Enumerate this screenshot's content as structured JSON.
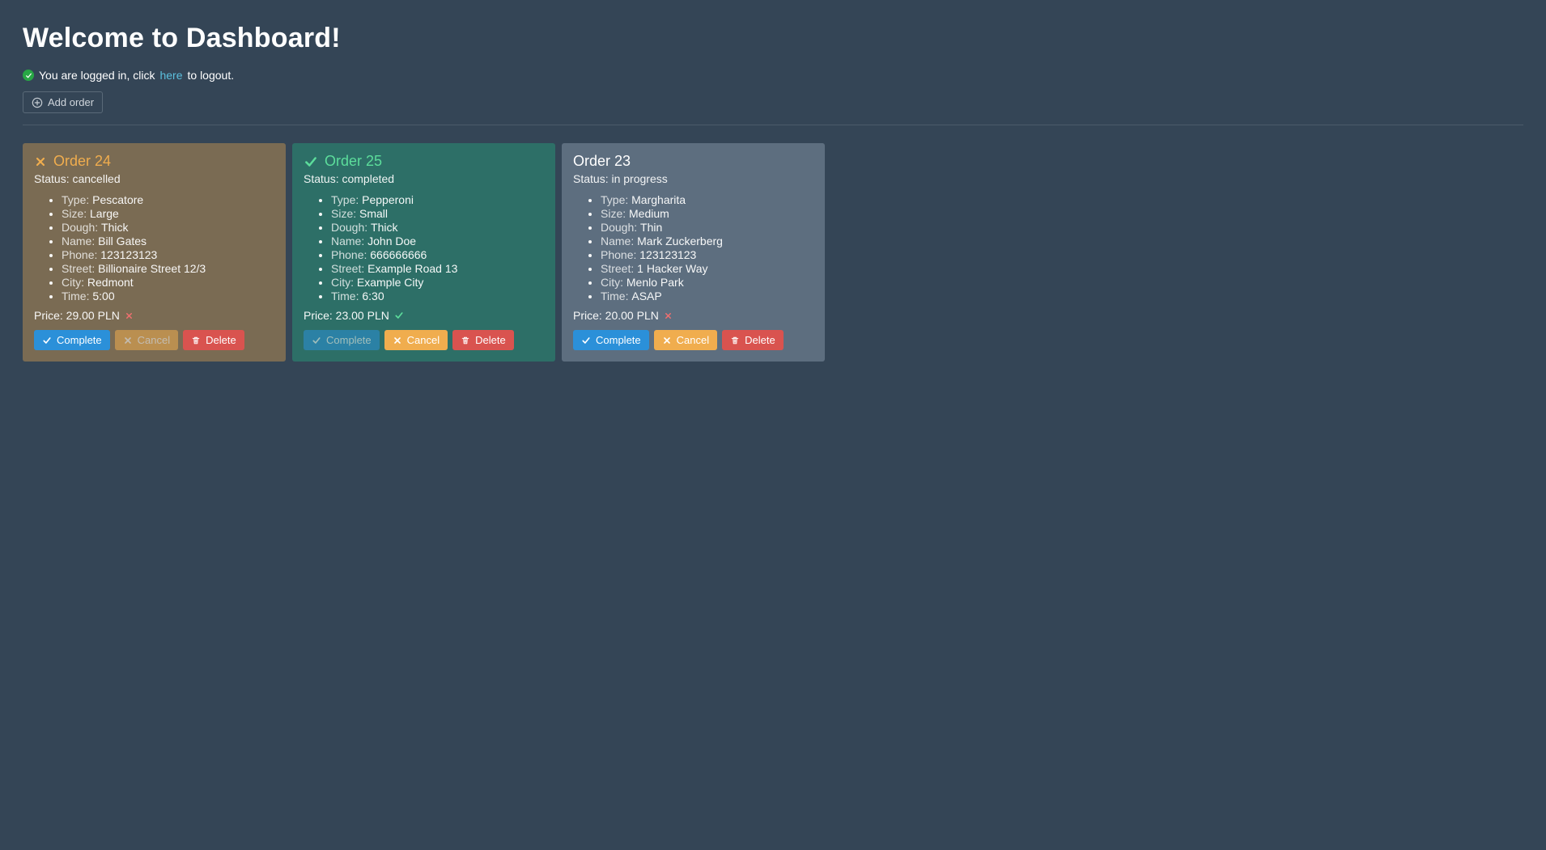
{
  "header": {
    "title": "Welcome to Dashboard!",
    "logged_in_prefix": "You are logged in, click ",
    "logout_link_text": "here",
    "logged_in_suffix": " to logout."
  },
  "toolbar": {
    "add_order_label": "Add order"
  },
  "labels": {
    "status_prefix": "Status: ",
    "type": "Type: ",
    "size": "Size: ",
    "dough": "Dough: ",
    "name": "Name: ",
    "phone": "Phone: ",
    "street": "Street: ",
    "city": "City: ",
    "time": "Time: ",
    "price_prefix": "Price: ",
    "complete": "Complete",
    "cancel": "Cancel",
    "delete": "Delete"
  },
  "orders": [
    {
      "title": "Order 24",
      "status": "cancelled",
      "type": "Pescatore",
      "size": "Large",
      "dough": "Thick",
      "name": "Bill Gates",
      "phone": "123123123",
      "street": "Billionaire Street 12/3",
      "city": "Redmont",
      "time": "5:00",
      "price": "29.00 PLN",
      "price_tick": "x",
      "complete_disabled": false,
      "cancel_disabled": true
    },
    {
      "title": "Order 25",
      "status": "completed",
      "type": "Pepperoni",
      "size": "Small",
      "dough": "Thick",
      "name": "John Doe",
      "phone": "666666666",
      "street": "Example Road 13",
      "city": "Example City",
      "time": "6:30",
      "price": "23.00 PLN",
      "price_tick": "check",
      "complete_disabled": true,
      "cancel_disabled": false
    },
    {
      "title": "Order 23",
      "status": "in progress",
      "type": "Margharita",
      "size": "Medium",
      "dough": "Thin",
      "name": "Mark Zuckerberg",
      "phone": "123123123",
      "street": "1 Hacker Way",
      "city": "Menlo Park",
      "time": "ASAP",
      "price": "20.00 PLN",
      "price_tick": "x",
      "complete_disabled": false,
      "cancel_disabled": false
    }
  ]
}
